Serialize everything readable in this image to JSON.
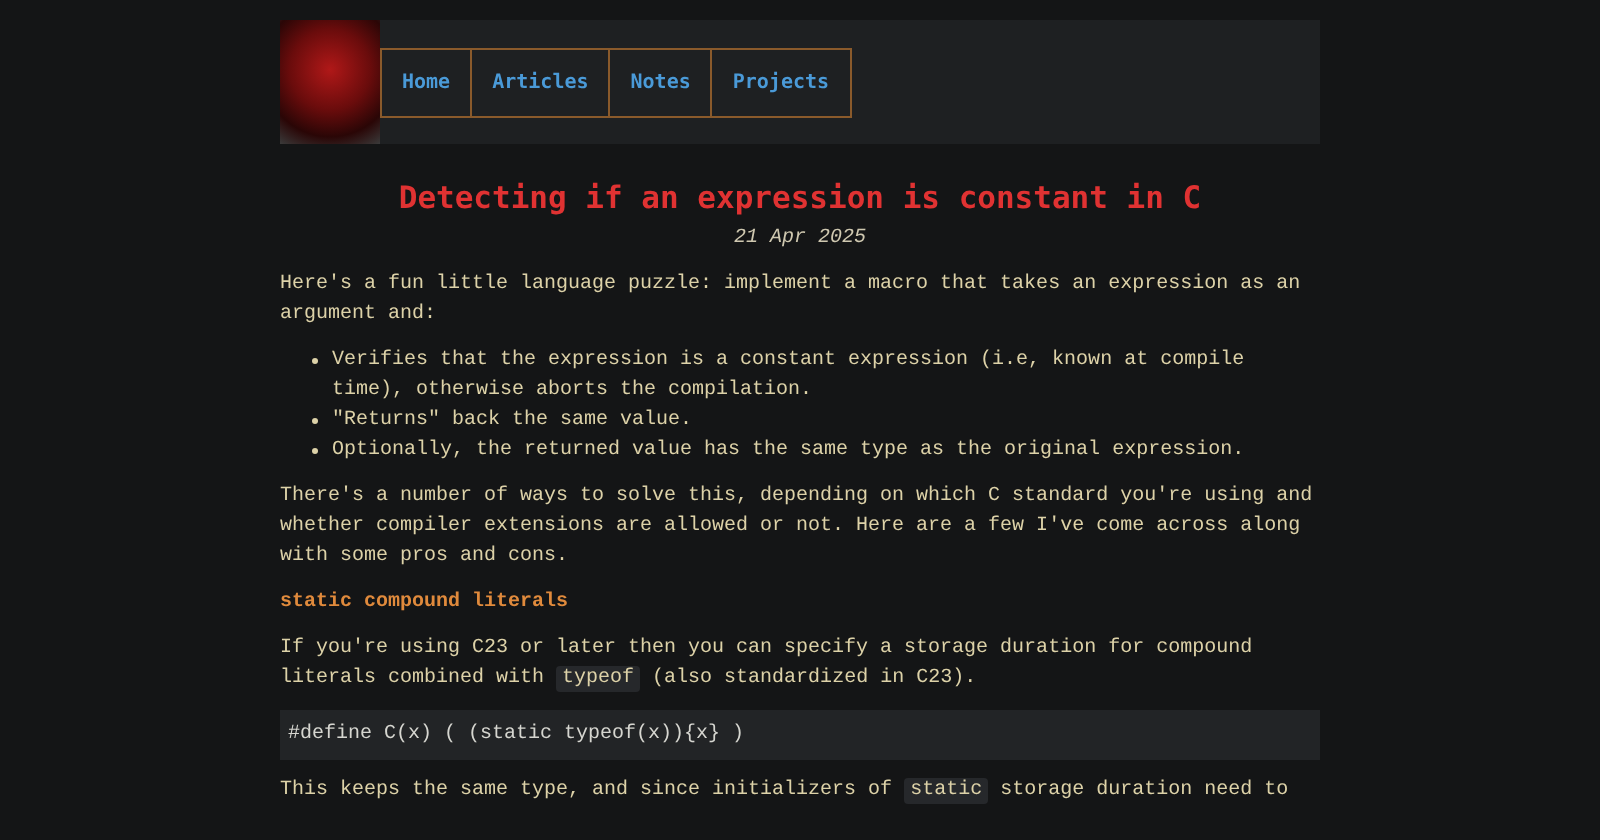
{
  "nav": {
    "items": [
      {
        "label": "Home"
      },
      {
        "label": "Articles"
      },
      {
        "label": "Notes"
      },
      {
        "label": "Projects"
      }
    ]
  },
  "article": {
    "title": "Detecting if an expression is constant in C",
    "date": "21 Apr 2025",
    "blocks": [
      {
        "kind": "paragraph",
        "segments": [
          {
            "kind": "text",
            "text": "Here's a fun little language puzzle: implement a macro that takes an expression as an argument and:"
          }
        ]
      },
      {
        "kind": "list",
        "items": [
          "Verifies that the expression is a constant expression (i.e, known at compile time), otherwise aborts the compilation.",
          "\"Returns\" back the same value.",
          "Optionally, the returned value has the same type as the original expression."
        ]
      },
      {
        "kind": "paragraph",
        "segments": [
          {
            "kind": "text",
            "text": "There's a number of ways to solve this, depending on which C standard you're using and whether compiler extensions are allowed or not. Here are a few I've come across along with some pros and cons."
          }
        ]
      },
      {
        "kind": "heading",
        "text": "static compound literals"
      },
      {
        "kind": "paragraph",
        "segments": [
          {
            "kind": "text",
            "text": "If you're using C23 or later then you can specify a storage duration for compound literals combined with "
          },
          {
            "kind": "code",
            "text": "typeof"
          },
          {
            "kind": "text",
            "text": " (also standardized in C23)."
          }
        ]
      },
      {
        "kind": "code",
        "text": "#define C(x) ( (static typeof(x)){x} )"
      },
      {
        "kind": "paragraph",
        "segments": [
          {
            "kind": "text",
            "text": "This keeps the same type, and since initializers of "
          },
          {
            "kind": "code",
            "text": "static"
          },
          {
            "kind": "text",
            "text": " storage duration need to"
          }
        ]
      }
    ]
  }
}
